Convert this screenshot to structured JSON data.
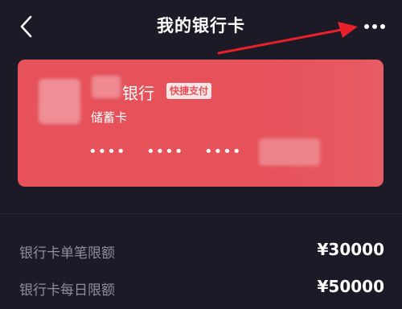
{
  "header": {
    "back_icon": "chevron-left-icon",
    "title": "我的银行卡",
    "more_icon": "more-horizontal-icon"
  },
  "card": {
    "bank_name": "银行",
    "badge": "快捷支付",
    "card_type": "储蓄卡",
    "masked_groups": [
      "••••",
      "••••",
      "••••"
    ],
    "background_color": "#e6515a"
  },
  "limits": [
    {
      "label": "银行卡单笔限额",
      "value": "¥30000"
    },
    {
      "label": "银行卡每日限额",
      "value": "¥50000"
    }
  ],
  "colors": {
    "page_background": "#1b1a26",
    "annotation_arrow": "#e8202a"
  }
}
